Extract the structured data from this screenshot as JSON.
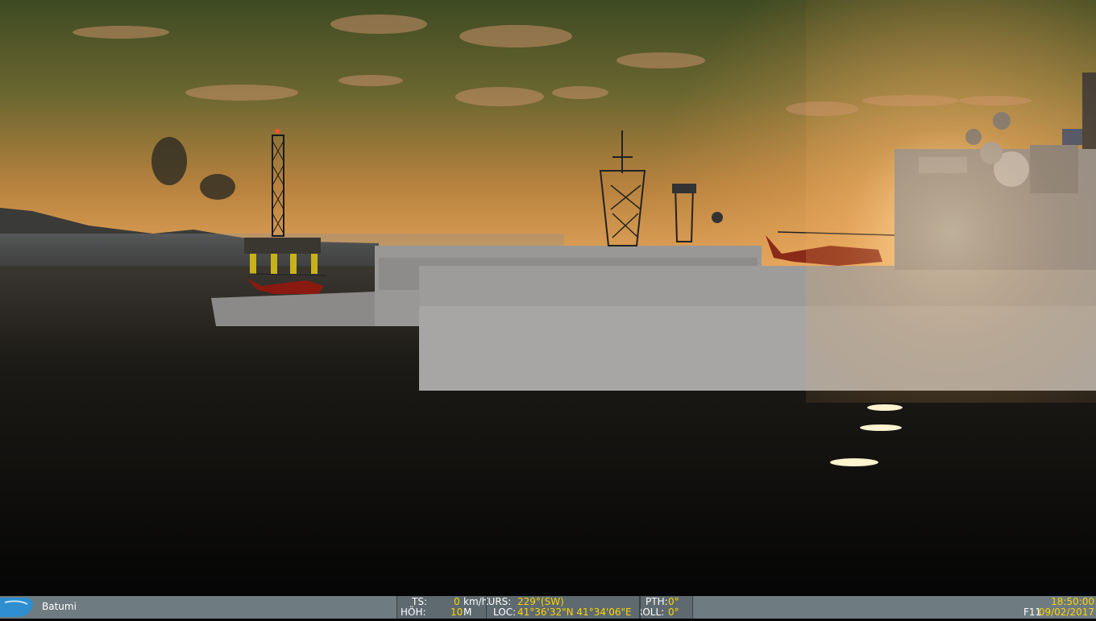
{
  "status_bar": {
    "location": "Batumi",
    "ts_label": "TS:",
    "ts_value": "0",
    "ts_unit": "km/h",
    "hoh_label": "HÖH:",
    "hoh_value": "10",
    "hoh_unit": "M",
    "kurs_label": "KURS:",
    "kurs_value": "229°(SW)",
    "loc_label": "LOC:",
    "loc_value": "41°36'32\"N 41°34'06\"E",
    "pth_label": "PTH:",
    "pth_value": "0°",
    "roll_label": "ROLL:",
    "roll_value": "0°",
    "view_key": "F11",
    "time": "18:50:00",
    "date": "09/02/2017"
  },
  "scene": {
    "description_icons": [
      "oil-rig-icon",
      "helicopter-icon",
      "warship-icon"
    ]
  },
  "colors": {
    "hud_bg": "#6e7b80",
    "hud_value": "#ffd400",
    "sky_top": "#4f5a2a",
    "sky_horizon": "#e09a4a"
  }
}
